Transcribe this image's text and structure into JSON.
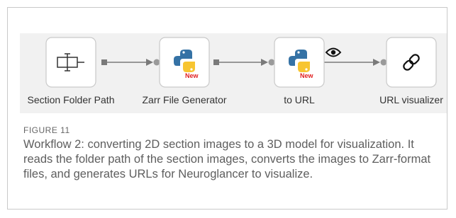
{
  "workflow": {
    "nodes": [
      {
        "id": "section-folder-path",
        "label": "Section Folder Path",
        "icon": "path-selector-icon",
        "badge": ""
      },
      {
        "id": "zarr-file-generator",
        "label": "Zarr File Generator",
        "icon": "python-icon",
        "badge": "New"
      },
      {
        "id": "to-url",
        "label": "to URL",
        "icon": "python-icon",
        "badge": "New"
      },
      {
        "id": "url-visualizer",
        "label": "URL visualizer",
        "icon": "link-icon",
        "badge": ""
      }
    ],
    "edge_with_eye": 2,
    "colors": {
      "background": "#f1f1f1",
      "node_border": "#c9c9c9",
      "connector": "#7a7a7a",
      "badge": "#e02020",
      "python_blue": "#3572a5",
      "python_yellow": "#f7c531"
    }
  },
  "figure": {
    "label": "FIGURE 11",
    "caption": "Workflow 2: converting 2D section images to a 3D model for visualization. It reads the folder path of the section images, converts the images to Zarr-format files, and generates URLs for Neuroglancer to visualize."
  }
}
